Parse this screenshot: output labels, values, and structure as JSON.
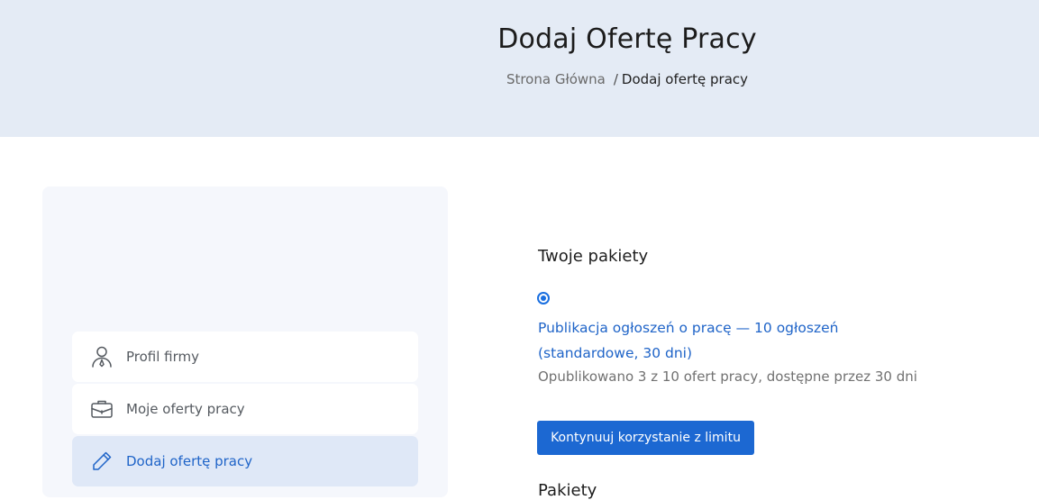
{
  "header": {
    "title": "Dodaj Ofertę Pracy",
    "breadcrumb": {
      "home": "Strona Główna",
      "separator": "/",
      "current": "Dodaj ofertę pracy"
    }
  },
  "sidebar": {
    "items": [
      {
        "label": "Profil firmy",
        "icon": "user-icon",
        "active": false
      },
      {
        "label": "Moje oferty pracy",
        "icon": "briefcase-icon",
        "active": false
      },
      {
        "label": "Dodaj ofertę pracy",
        "icon": "pencil-icon",
        "active": true
      }
    ]
  },
  "main": {
    "heading": "Twoje pakiety",
    "package": {
      "selected": true,
      "name": "Publikacja ogłoszeń o pracę — 10 ogłoszeń (standardowe, 30 dni)",
      "description": "Opublikowano 3 z 10 ofert pracy, dostępne przez 30 dni"
    },
    "continue_button": "Kontynuuj korzystanie z limitu",
    "next_heading_partial": "Pakiety"
  },
  "colors": {
    "accent": "#1c68d2",
    "hero_background": "#e4ebf5",
    "sidebar_background": "#f5f7fc",
    "active_item_background": "#dfe8f7"
  }
}
